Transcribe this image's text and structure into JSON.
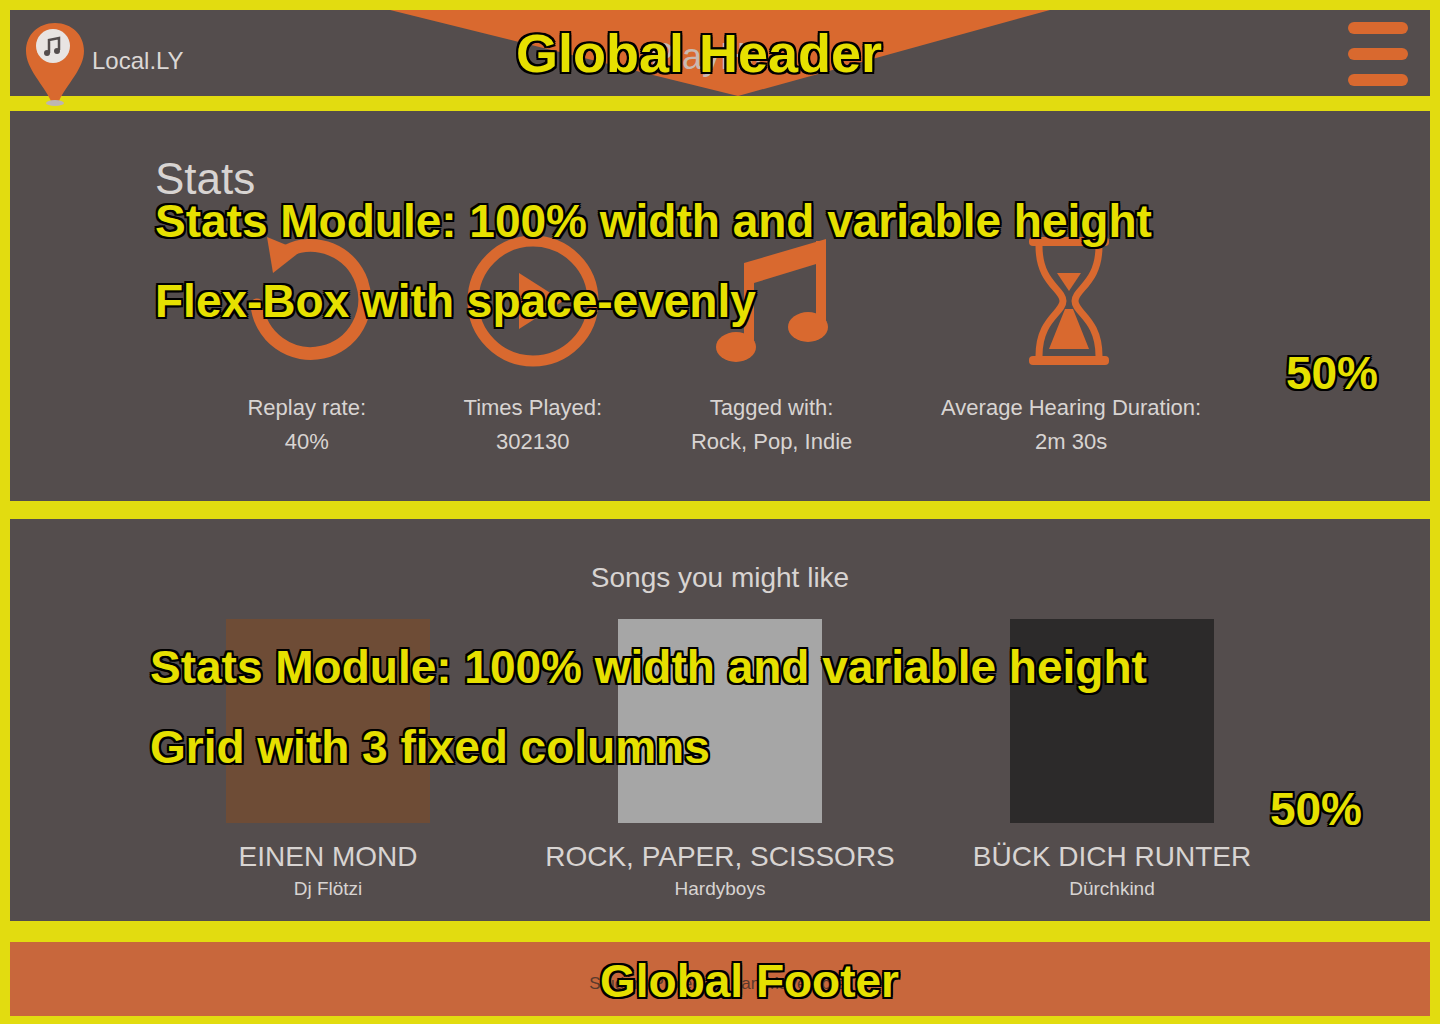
{
  "header": {
    "brand": "Local.LY",
    "title": "PlayHit",
    "annotation": "Global Header"
  },
  "stats": {
    "title": "Stats",
    "annotation": [
      "Stats Module: 100% width and variable height",
      "Flex-Box with space-evenly"
    ],
    "share": "50%",
    "items": [
      {
        "label": "Replay rate:",
        "value": "40%"
      },
      {
        "label": "Times Played:",
        "value": "302130"
      },
      {
        "label": "Tagged with:",
        "value": "Rock, Pop, Indie"
      },
      {
        "label": "Average Hearing Duration:",
        "value": "2m 30s"
      }
    ]
  },
  "songs": {
    "title": "Songs you might like",
    "annotation": [
      "Stats Module: 100% width and variable height",
      "Grid with 3 fixed columns"
    ],
    "share": "50%",
    "items": [
      {
        "title": "EINEN MOND",
        "artist": "Dj Flötzi"
      },
      {
        "title": "ROCK, PAPER, SCISSORS",
        "artist": "Hardyboys"
      },
      {
        "title": "BÜCK DICH RUNTER",
        "artist": "Dürchkind"
      }
    ]
  },
  "footer": {
    "text": "Student Project by Jan Mayerhofer",
    "annotation": "Global Footer"
  }
}
